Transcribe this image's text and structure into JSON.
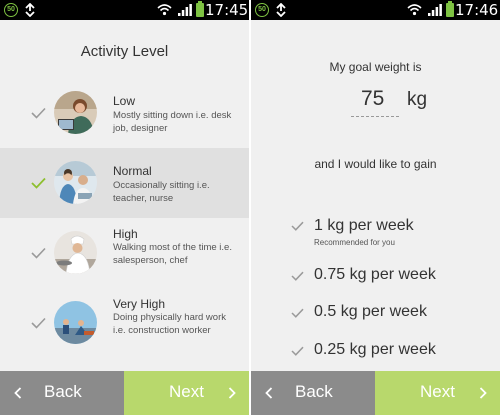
{
  "left_screen": {
    "status": {
      "badge": "50",
      "time": "17:45"
    },
    "title": "Activity Level",
    "items": [
      {
        "label": "Low",
        "description": "Mostly sitting down i.e. desk job, designer",
        "selected": false
      },
      {
        "label": "Normal",
        "description": "Occasionally sitting i.e. teacher, nurse",
        "selected": true
      },
      {
        "label": "High",
        "description": "Walking most of the time i.e. salesperson, chef",
        "selected": false
      },
      {
        "label": "Very High",
        "description": "Doing physically hard work i.e. construction worker",
        "selected": false
      }
    ],
    "back_label": "Back",
    "next_label": "Next"
  },
  "right_screen": {
    "status": {
      "badge": "50",
      "time": "17:46"
    },
    "goal_label": "My goal weight is",
    "goal_value": "75",
    "goal_unit": "kg",
    "gain_label": "and I would like to gain",
    "rates": [
      {
        "label": "1 kg per week",
        "note": "Recommended for you"
      },
      {
        "label": "0.75 kg per week"
      },
      {
        "label": "0.5 kg per week"
      },
      {
        "label": "0.25 kg per week"
      }
    ],
    "back_label": "Back",
    "next_label": "Next"
  },
  "colors": {
    "accent_green": "#b8d86c",
    "check_green": "#8dbf2f",
    "check_grey": "#9a9a9a",
    "back_grey": "#8b8b8b",
    "background": "#f0f0f0",
    "selected_row": "#e0e0e0"
  },
  "icons": [
    "data-saver-icon",
    "sync-icon",
    "wifi-icon",
    "signal-icon",
    "battery-icon",
    "check-icon",
    "chevron-left-icon",
    "chevron-right-icon"
  ]
}
